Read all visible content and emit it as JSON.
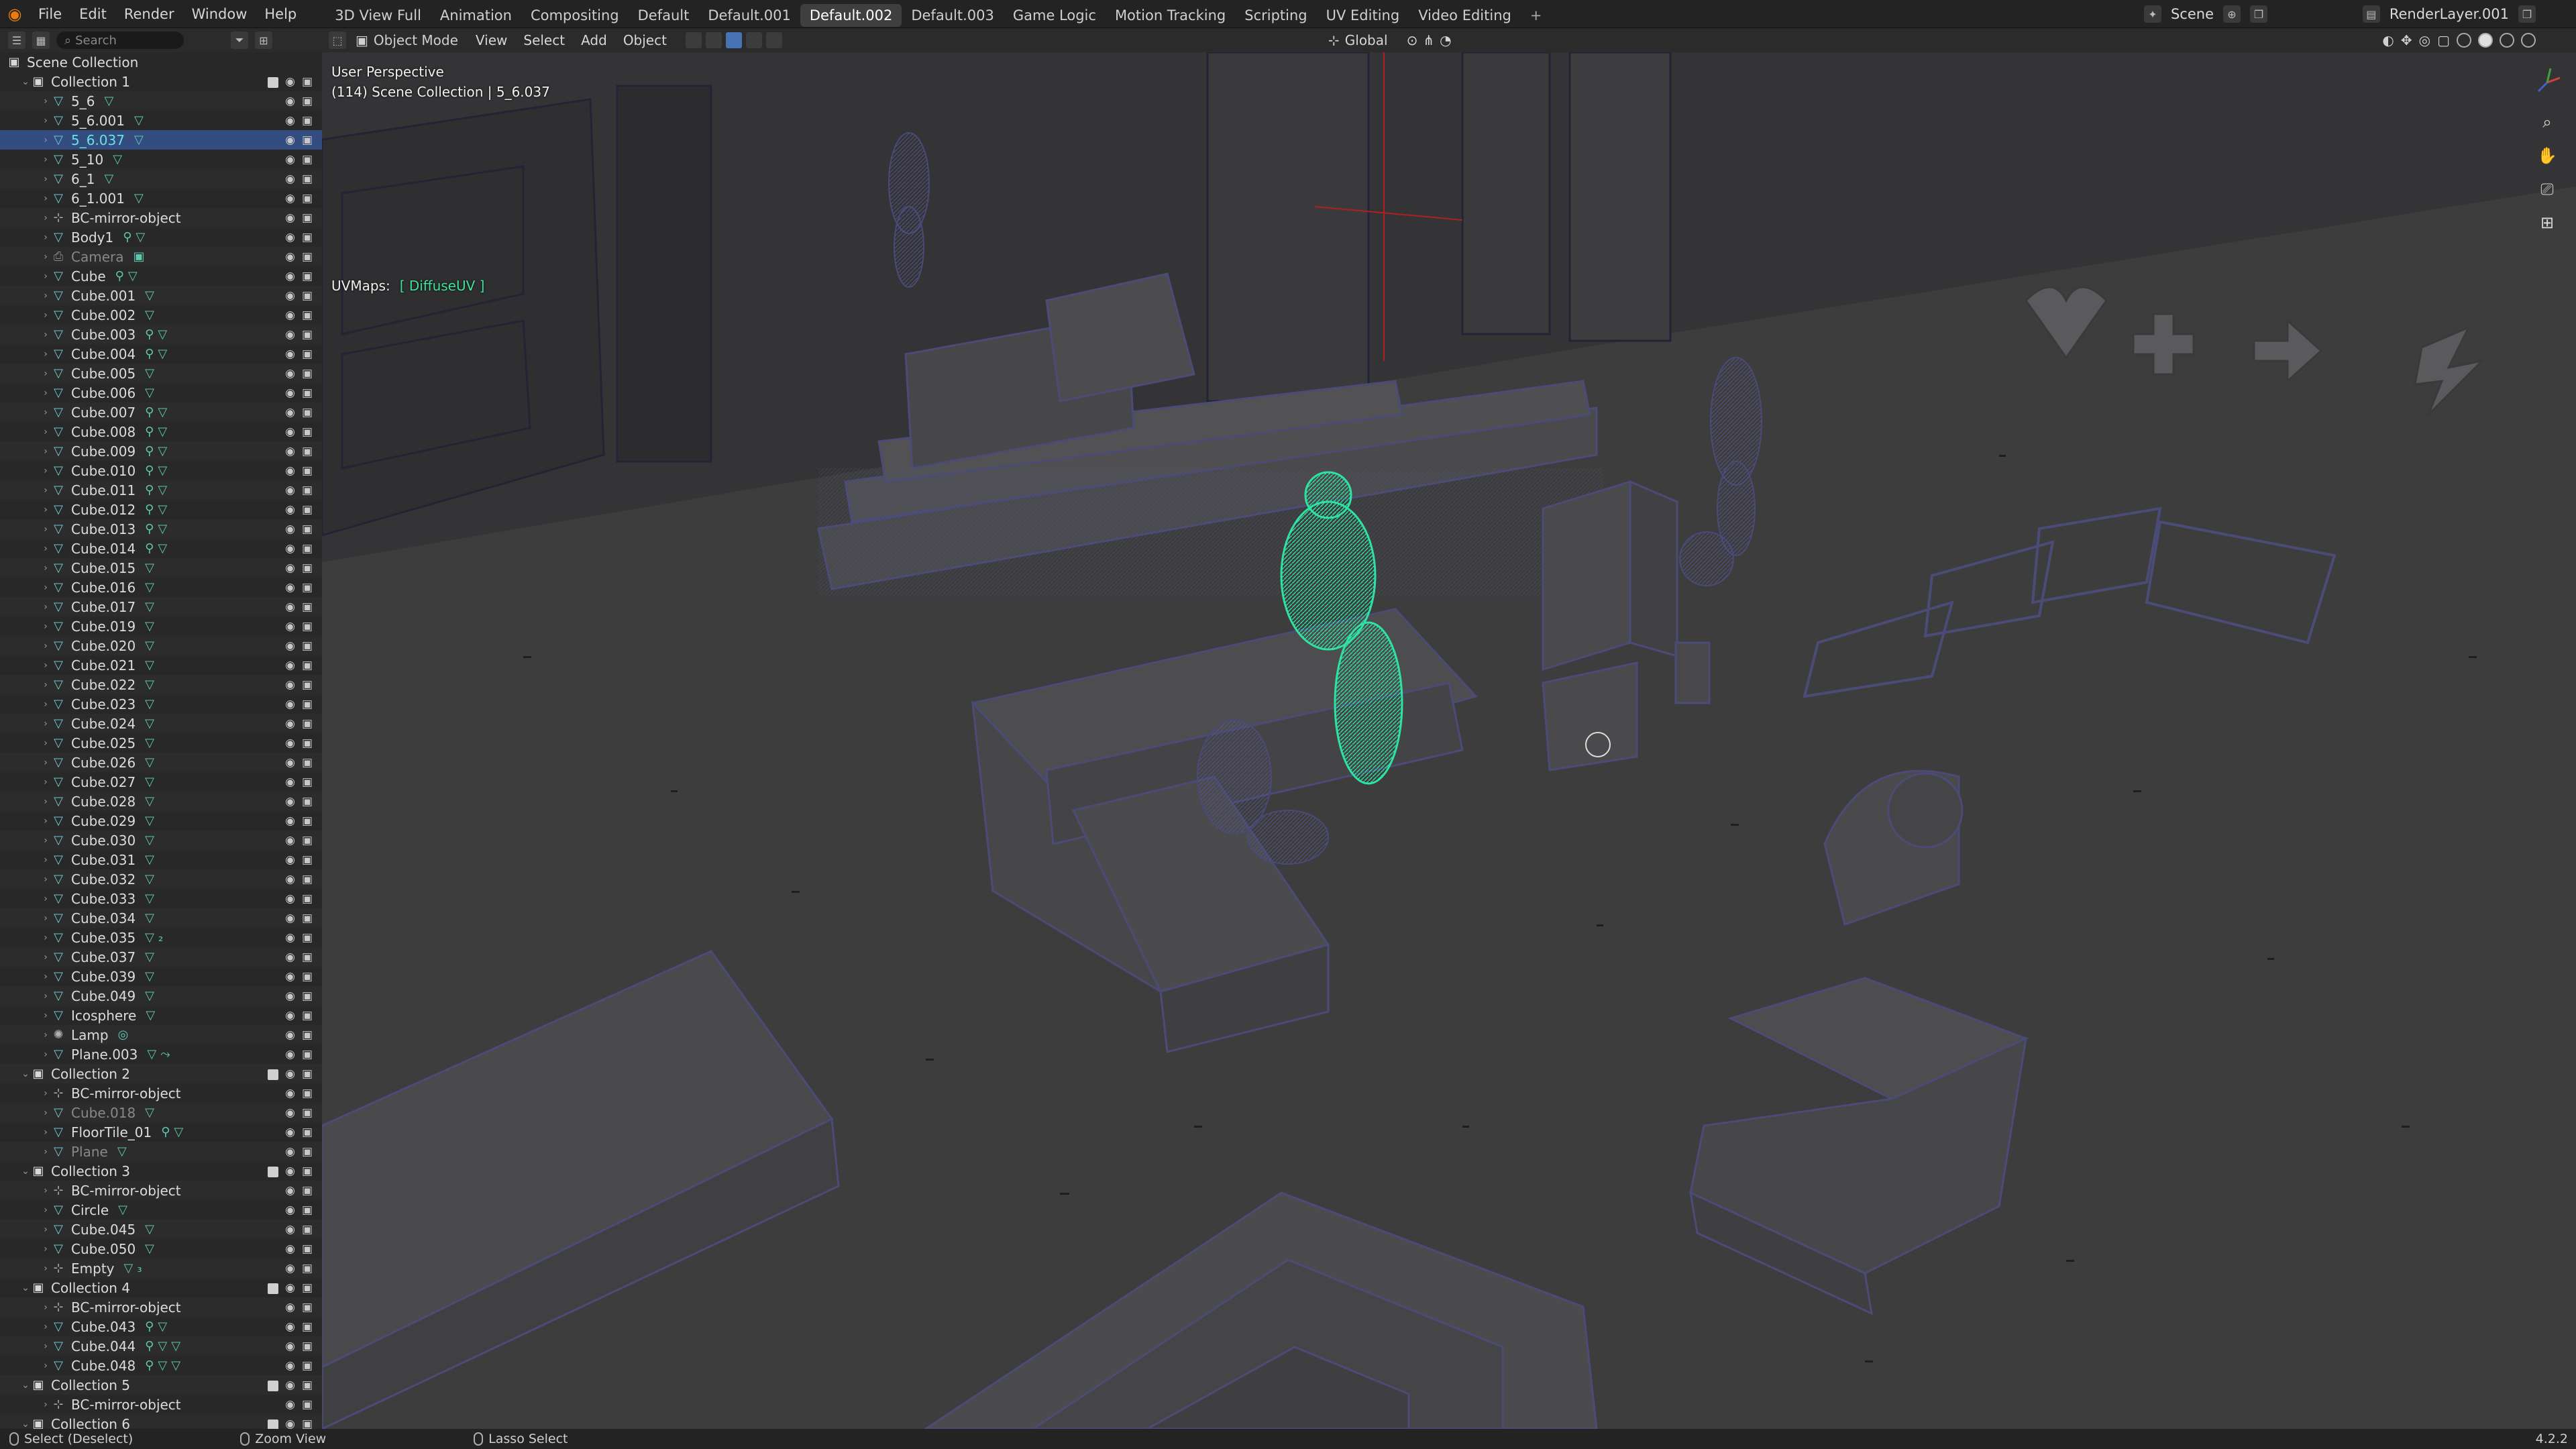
{
  "menu": [
    "File",
    "Edit",
    "Render",
    "Window",
    "Help"
  ],
  "workspaces": [
    {
      "label": "3D View Full",
      "active": false
    },
    {
      "label": "Animation",
      "active": false
    },
    {
      "label": "Compositing",
      "active": false
    },
    {
      "label": "Default",
      "active": false
    },
    {
      "label": "Default.001",
      "active": false
    },
    {
      "label": "Default.002",
      "active": true
    },
    {
      "label": "Default.003",
      "active": false
    },
    {
      "label": "Game Logic",
      "active": false
    },
    {
      "label": "Motion Tracking",
      "active": false
    },
    {
      "label": "Scripting",
      "active": false
    },
    {
      "label": "UV Editing",
      "active": false
    },
    {
      "label": "Video Editing",
      "active": false
    }
  ],
  "add_workspace": "+",
  "scene_name": "Scene",
  "render_layer": "RenderLayer.001",
  "outliner": {
    "search_placeholder": "Search",
    "root": "Scene Collection",
    "rows": [
      {
        "name": "Collection 1",
        "type": "coll",
        "depth": 1,
        "expanded": true,
        "check": true
      },
      {
        "name": "5_6",
        "type": "mesh",
        "depth": 2,
        "extra": "▽"
      },
      {
        "name": "5_6.001",
        "type": "mesh",
        "depth": 2,
        "extra": "▽"
      },
      {
        "name": "5_6.037",
        "type": "mesh",
        "depth": 2,
        "extra": "▽",
        "selected": true
      },
      {
        "name": "5_10",
        "type": "mesh",
        "depth": 2,
        "extra": "▽"
      },
      {
        "name": "6_1",
        "type": "mesh",
        "depth": 2,
        "extra": "▽"
      },
      {
        "name": "6_1.001",
        "type": "mesh",
        "depth": 2,
        "extra": "▽"
      },
      {
        "name": "BC-mirror-object",
        "type": "empty",
        "depth": 2,
        "extra": ""
      },
      {
        "name": "Body1",
        "type": "mesh",
        "depth": 2,
        "extra": "⚲▽"
      },
      {
        "name": "Camera",
        "type": "cam",
        "depth": 2,
        "extra": "▣",
        "dim": true
      },
      {
        "name": "Cube",
        "type": "mesh",
        "depth": 2,
        "extra": "⚲▽"
      },
      {
        "name": "Cube.001",
        "type": "mesh",
        "depth": 2,
        "extra": "▽"
      },
      {
        "name": "Cube.002",
        "type": "mesh",
        "depth": 2,
        "extra": "▽"
      },
      {
        "name": "Cube.003",
        "type": "mesh",
        "depth": 2,
        "extra": "⚲▽"
      },
      {
        "name": "Cube.004",
        "type": "mesh",
        "depth": 2,
        "extra": "⚲▽"
      },
      {
        "name": "Cube.005",
        "type": "mesh",
        "depth": 2,
        "extra": "▽"
      },
      {
        "name": "Cube.006",
        "type": "mesh",
        "depth": 2,
        "extra": "▽"
      },
      {
        "name": "Cube.007",
        "type": "mesh",
        "depth": 2,
        "extra": "⚲▽"
      },
      {
        "name": "Cube.008",
        "type": "mesh",
        "depth": 2,
        "extra": "⚲▽"
      },
      {
        "name": "Cube.009",
        "type": "mesh",
        "depth": 2,
        "extra": "⚲▽"
      },
      {
        "name": "Cube.010",
        "type": "mesh",
        "depth": 2,
        "extra": "⚲▽"
      },
      {
        "name": "Cube.011",
        "type": "mesh",
        "depth": 2,
        "extra": "⚲▽"
      },
      {
        "name": "Cube.012",
        "type": "mesh",
        "depth": 2,
        "extra": "⚲▽"
      },
      {
        "name": "Cube.013",
        "type": "mesh",
        "depth": 2,
        "extra": "⚲▽"
      },
      {
        "name": "Cube.014",
        "type": "mesh",
        "depth": 2,
        "extra": "⚲▽"
      },
      {
        "name": "Cube.015",
        "type": "mesh",
        "depth": 2,
        "extra": "▽"
      },
      {
        "name": "Cube.016",
        "type": "mesh",
        "depth": 2,
        "extra": "▽"
      },
      {
        "name": "Cube.017",
        "type": "mesh",
        "depth": 2,
        "extra": "▽"
      },
      {
        "name": "Cube.019",
        "type": "mesh",
        "depth": 2,
        "extra": "▽"
      },
      {
        "name": "Cube.020",
        "type": "mesh",
        "depth": 2,
        "extra": "▽"
      },
      {
        "name": "Cube.021",
        "type": "mesh",
        "depth": 2,
        "extra": "▽"
      },
      {
        "name": "Cube.022",
        "type": "mesh",
        "depth": 2,
        "extra": "▽"
      },
      {
        "name": "Cube.023",
        "type": "mesh",
        "depth": 2,
        "extra": "▽"
      },
      {
        "name": "Cube.024",
        "type": "mesh",
        "depth": 2,
        "extra": "▽"
      },
      {
        "name": "Cube.025",
        "type": "mesh",
        "depth": 2,
        "extra": "▽"
      },
      {
        "name": "Cube.026",
        "type": "mesh",
        "depth": 2,
        "extra": "▽"
      },
      {
        "name": "Cube.027",
        "type": "mesh",
        "depth": 2,
        "extra": "▽"
      },
      {
        "name": "Cube.028",
        "type": "mesh",
        "depth": 2,
        "extra": "▽"
      },
      {
        "name": "Cube.029",
        "type": "mesh",
        "depth": 2,
        "extra": "▽"
      },
      {
        "name": "Cube.030",
        "type": "mesh",
        "depth": 2,
        "extra": "▽"
      },
      {
        "name": "Cube.031",
        "type": "mesh",
        "depth": 2,
        "extra": "▽"
      },
      {
        "name": "Cube.032",
        "type": "mesh",
        "depth": 2,
        "extra": "▽"
      },
      {
        "name": "Cube.033",
        "type": "mesh",
        "depth": 2,
        "extra": "▽"
      },
      {
        "name": "Cube.034",
        "type": "mesh",
        "depth": 2,
        "extra": "▽"
      },
      {
        "name": "Cube.035",
        "type": "mesh",
        "depth": 2,
        "extra": "▽₂"
      },
      {
        "name": "Cube.037",
        "type": "mesh",
        "depth": 2,
        "extra": "▽"
      },
      {
        "name": "Cube.039",
        "type": "mesh",
        "depth": 2,
        "extra": "▽"
      },
      {
        "name": "Cube.049",
        "type": "mesh",
        "depth": 2,
        "extra": "▽"
      },
      {
        "name": "Icosphere",
        "type": "mesh",
        "depth": 2,
        "extra": "▽"
      },
      {
        "name": "Lamp",
        "type": "lamp",
        "depth": 2,
        "extra": "◎"
      },
      {
        "name": "Plane.003",
        "type": "mesh",
        "depth": 2,
        "extra": "▽⤳"
      },
      {
        "name": "Collection 2",
        "type": "coll",
        "depth": 1,
        "expanded": true,
        "check": true
      },
      {
        "name": "BC-mirror-object",
        "type": "empty",
        "depth": 2,
        "extra": ""
      },
      {
        "name": "Cube.018",
        "type": "mesh",
        "depth": 2,
        "extra": "▽",
        "dim": true
      },
      {
        "name": "FloorTile_01",
        "type": "mesh",
        "depth": 2,
        "extra": "⚲▽"
      },
      {
        "name": "Plane",
        "type": "mesh",
        "depth": 2,
        "extra": "▽",
        "dim": true
      },
      {
        "name": "Collection 3",
        "type": "coll",
        "depth": 1,
        "expanded": true,
        "check": true
      },
      {
        "name": "BC-mirror-object",
        "type": "empty",
        "depth": 2,
        "extra": ""
      },
      {
        "name": "Circle",
        "type": "mesh",
        "depth": 2,
        "extra": "▽"
      },
      {
        "name": "Cube.045",
        "type": "mesh",
        "depth": 2,
        "extra": "▽"
      },
      {
        "name": "Cube.050",
        "type": "mesh",
        "depth": 2,
        "extra": "▽"
      },
      {
        "name": "Empty",
        "type": "empty",
        "depth": 2,
        "extra": "▽₃"
      },
      {
        "name": "Collection 4",
        "type": "coll",
        "depth": 1,
        "expanded": true,
        "check": true
      },
      {
        "name": "BC-mirror-object",
        "type": "empty",
        "depth": 2,
        "extra": ""
      },
      {
        "name": "Cube.043",
        "type": "mesh",
        "depth": 2,
        "extra": "⚲▽"
      },
      {
        "name": "Cube.044",
        "type": "mesh",
        "depth": 2,
        "extra": "⚲▽▽"
      },
      {
        "name": "Cube.048",
        "type": "mesh",
        "depth": 2,
        "extra": "⚲▽▽"
      },
      {
        "name": "Collection 5",
        "type": "coll",
        "depth": 1,
        "expanded": true,
        "check": true
      },
      {
        "name": "BC-mirror-object",
        "type": "empty",
        "depth": 2,
        "extra": ""
      },
      {
        "name": "Collection 6",
        "type": "coll",
        "depth": 1,
        "expanded": true,
        "check": true
      }
    ]
  },
  "viewport_header": {
    "mode": "Object Mode",
    "menus": [
      "View",
      "Select",
      "Add",
      "Object"
    ],
    "orientation": "Global"
  },
  "viewport": {
    "perspective": "User Perspective",
    "context": "(114) Scene Collection | 5_6.037",
    "uvmaps_label": "UVMaps:",
    "uvmaps_value": "[ DiffuseUV ]"
  },
  "status": {
    "left": "Select (Deselect)",
    "middle": "Zoom View",
    "right": "Lasso Select",
    "version": "4.2.2"
  },
  "colors": {
    "accent_selected": "#334d80",
    "active_object": "#3de39b",
    "mesh_icon": "#6fc7d0",
    "wire": "#6e6f9e"
  }
}
